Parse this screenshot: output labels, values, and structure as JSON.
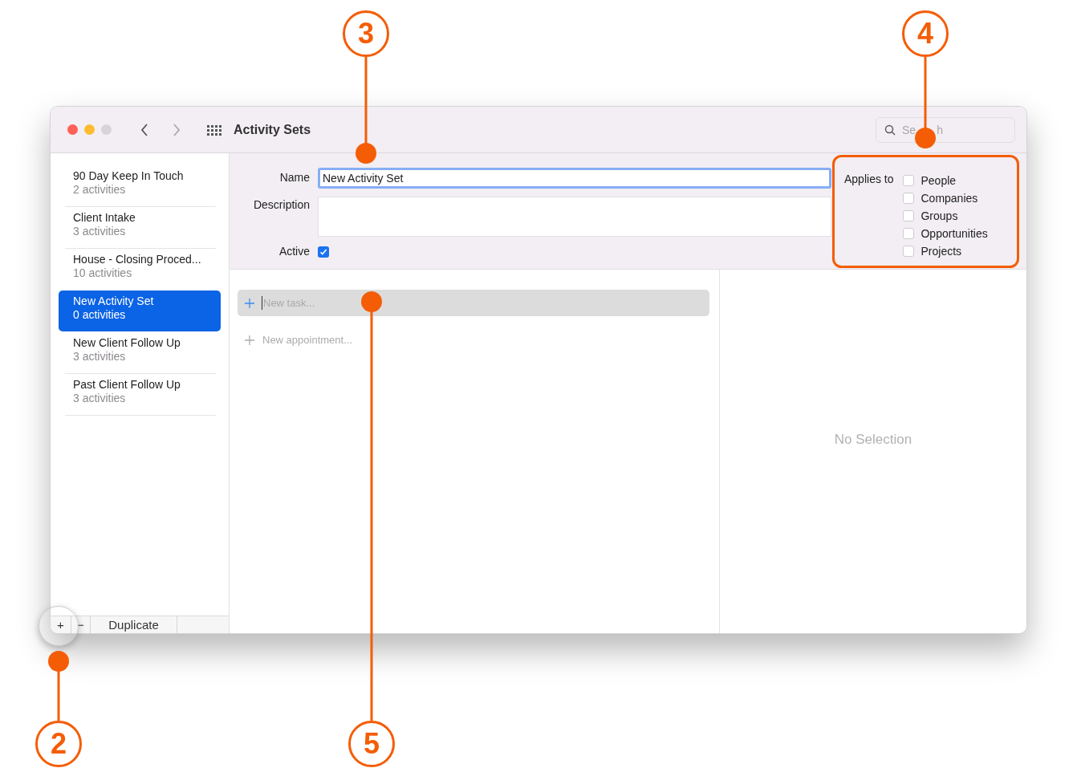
{
  "window": {
    "title": "Activity Sets"
  },
  "search": {
    "placeholder_parts": [
      "Se",
      "h"
    ]
  },
  "sidebar": {
    "items": [
      {
        "title": "90 Day Keep In Touch",
        "subtitle": "2 activities",
        "selected": false
      },
      {
        "title": "Client Intake",
        "subtitle": "3 activities",
        "selected": false
      },
      {
        "title": "House - Closing Proced...",
        "subtitle": "10 activities",
        "selected": false
      },
      {
        "title": "New Activity Set",
        "subtitle": "0 activities",
        "selected": true
      },
      {
        "title": "New Client Follow Up",
        "subtitle": "3 activities",
        "selected": false
      },
      {
        "title": "Past Client Follow Up",
        "subtitle": "3 activities",
        "selected": false
      }
    ],
    "footer": {
      "add": "+",
      "remove": "−",
      "duplicate": "Duplicate"
    }
  },
  "form": {
    "name_label": "Name",
    "name_value": "New Activity Set",
    "description_label": "Description",
    "active_label": "Active",
    "active_checked": true
  },
  "applies_to": {
    "label": "Applies to",
    "options": [
      {
        "label": "People",
        "checked": false
      },
      {
        "label": "Companies",
        "checked": false
      },
      {
        "label": "Groups",
        "checked": false
      },
      {
        "label": "Opportunities",
        "checked": false
      },
      {
        "label": "Projects",
        "checked": false
      }
    ]
  },
  "activities": {
    "new_task_placeholder": "New task...",
    "new_appointment": "New appointment..."
  },
  "detail": {
    "empty_text": "No Selection"
  },
  "callouts": [
    {
      "number": "3"
    },
    {
      "number": "4"
    },
    {
      "number": "2"
    },
    {
      "number": "5"
    }
  ]
}
